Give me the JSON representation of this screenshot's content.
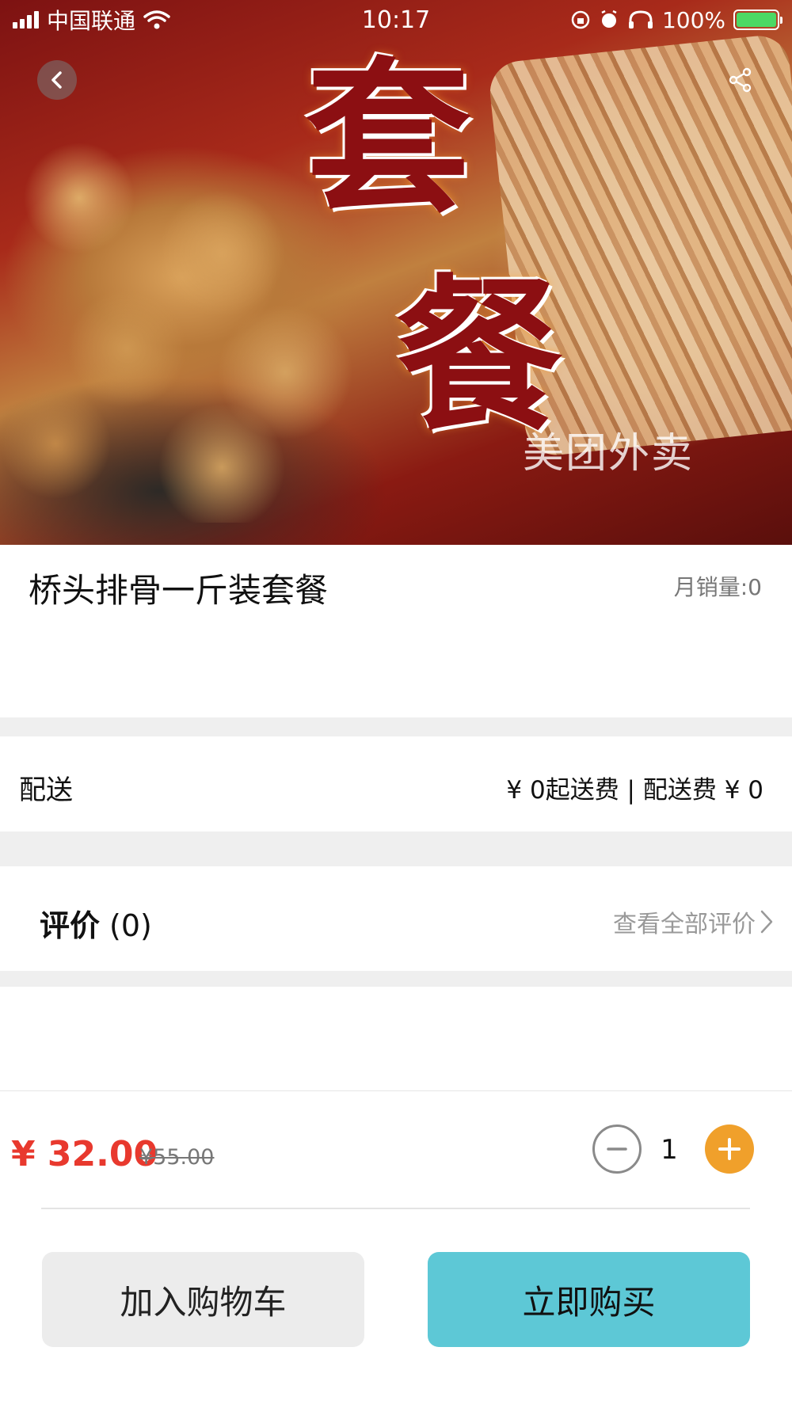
{
  "status_bar": {
    "carrier": "中国联通",
    "time": "10:17",
    "battery_percent": "100%"
  },
  "hero": {
    "char_1": "套",
    "char_2": "餐",
    "watermark": "美团外卖",
    "back_icon": "chevron-left-icon",
    "share_icon": "share-icon"
  },
  "product": {
    "name": "桥头排骨一斤装套餐",
    "monthly_sales": "月销量:0"
  },
  "delivery": {
    "label": "配送",
    "info": "¥ 0起送费 | 配送费 ¥ 0"
  },
  "reviews": {
    "title": "评价",
    "count": "(0)",
    "view_all": "查看全部评价"
  },
  "price": {
    "current": "¥ 32.00",
    "original": "¥55.00"
  },
  "quantity": {
    "value": "1"
  },
  "actions": {
    "add_to_cart": "加入购物车",
    "buy_now": "立即购买"
  },
  "colors": {
    "price_red": "#e8392e",
    "plus_orange": "#f0a02b",
    "buy_teal": "#5dc8d6",
    "cart_gray": "#ececec"
  }
}
